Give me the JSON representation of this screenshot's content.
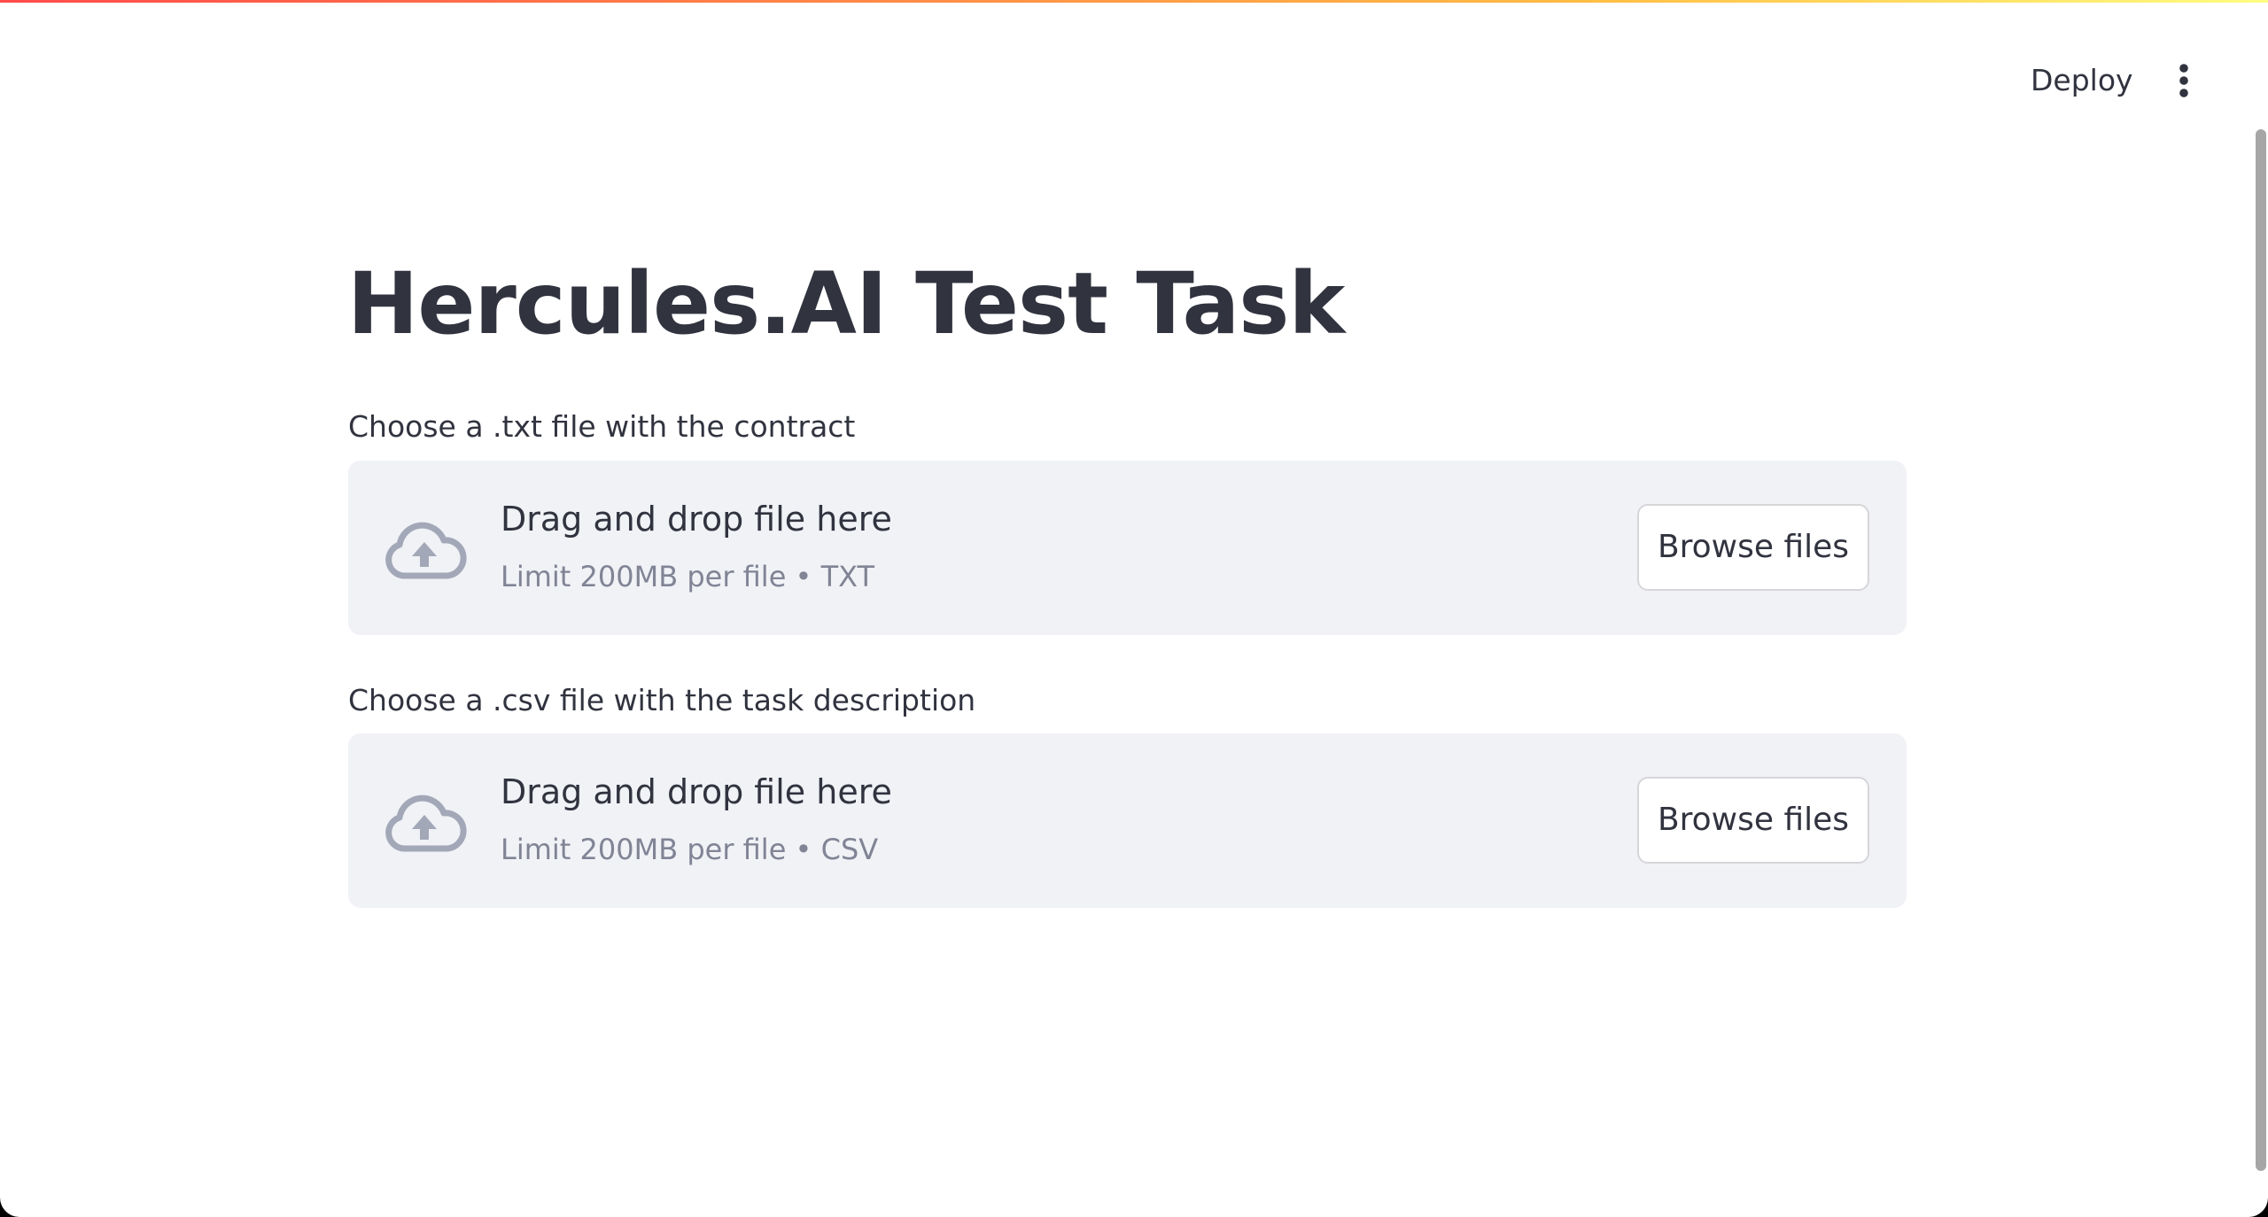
{
  "header": {
    "deploy_label": "Deploy",
    "menu_icon": "vertical-dots-icon"
  },
  "main": {
    "title": "Hercules.AI Test Task",
    "uploaders": [
      {
        "label": "Choose a .txt file with the contract",
        "dropzone_title": "Drag and drop file here",
        "limit_text": "Limit 200MB per file • TXT",
        "browse_label": "Browse files",
        "icon": "cloud-upload-icon"
      },
      {
        "label": "Choose a .csv file with the task description",
        "dropzone_title": "Drag and drop file here",
        "limit_text": "Limit 200MB per file • CSV",
        "browse_label": "Browse files",
        "icon": "cloud-upload-icon"
      }
    ]
  },
  "colors": {
    "text": "#31333f",
    "muted": "#808495",
    "dropzone_bg": "#f0f2f6",
    "icon": "#a3a8b8",
    "accent_start": "#ff4b4b",
    "accent_end": "#fffd80"
  }
}
